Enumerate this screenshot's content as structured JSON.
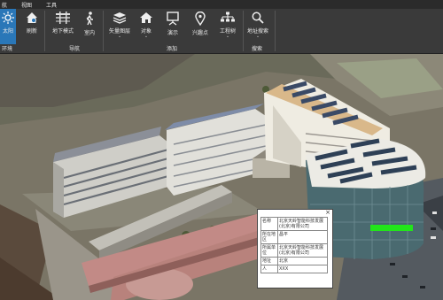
{
  "menu": [
    "航",
    "视图",
    "工具"
  ],
  "ribbon": {
    "buttons": [
      {
        "label": "太阳",
        "icon": "sun-icon",
        "active": true
      },
      {
        "label": "刷新",
        "icon": "home-refresh-icon"
      },
      {
        "label": "地下模式",
        "icon": "underground-icon"
      },
      {
        "label": "室内",
        "icon": "walk-icon"
      },
      {
        "label": "矢量图层",
        "icon": "layers-icon",
        "dropdown": "⌄"
      },
      {
        "label": "对象",
        "icon": "house-object-icon",
        "dropdown": "⌄"
      },
      {
        "label": "演示",
        "icon": "presentation-icon"
      },
      {
        "label": "兴趣点",
        "icon": "pin-icon"
      },
      {
        "label": "工程树",
        "icon": "tree-icon",
        "dropdown": "⌄"
      },
      {
        "label": "地址搜索",
        "icon": "search-icon",
        "dropdown": "⌄"
      }
    ],
    "groups": [
      "环境",
      "导航",
      "添加",
      "搜索"
    ]
  },
  "popup": {
    "close": "×",
    "rows": [
      {
        "k": "名称",
        "v": "北京天岭智能科技发展(北京)有限公司"
      },
      {
        "k": "所在地区",
        "v": "昌平"
      },
      {
        "k": "所属单位",
        "v": "北京天岭智能科技发展(北京)有限公司"
      },
      {
        "k": "地址",
        "v": "北京"
      },
      {
        "k": "人",
        "v": "XXX"
      }
    ]
  },
  "colors": {
    "active": "#2a77b8",
    "highlight": "#22e51a"
  }
}
